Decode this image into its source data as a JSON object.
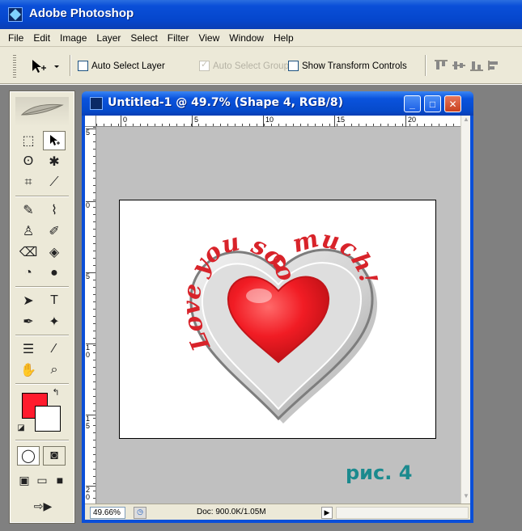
{
  "app": {
    "title": "Adobe Photoshop",
    "icon": "photoshop-icon"
  },
  "menu": [
    "File",
    "Edit",
    "Image",
    "Layer",
    "Select",
    "Filter",
    "View",
    "Window",
    "Help"
  ],
  "options": {
    "auto_select_layer": "Auto Select Layer",
    "auto_select_groups": "Auto Select Groups",
    "show_transform_controls": "Show Transform Controls",
    "auto_select_layer_checked": false,
    "auto_select_groups_enabled": false,
    "show_transform_controls_checked": false
  },
  "document": {
    "title": "Untitled-1 @ 49.7% (Shape 4, RGB/8)",
    "window_buttons": {
      "minimize": "_",
      "maximize": "□",
      "close": "✕"
    },
    "ruler_h_labels": [
      "0",
      "5",
      "10",
      "15",
      "20"
    ],
    "ruler_v_labels": [
      "5",
      "0",
      "5",
      "1 0",
      "1 5",
      "2 0"
    ],
    "artwork": {
      "curved_text": "Love you sooo much!",
      "heart_color": "#e8232b",
      "plate_color": "#d9d9d9"
    }
  },
  "status": {
    "zoom": "49.66%",
    "doc_info": "Doc: 900.0K/1.05M"
  },
  "colors": {
    "foreground": "#ff1b2d",
    "background": "#ffffff",
    "accent": "#0a4fd8"
  },
  "caption": "рис. 4"
}
